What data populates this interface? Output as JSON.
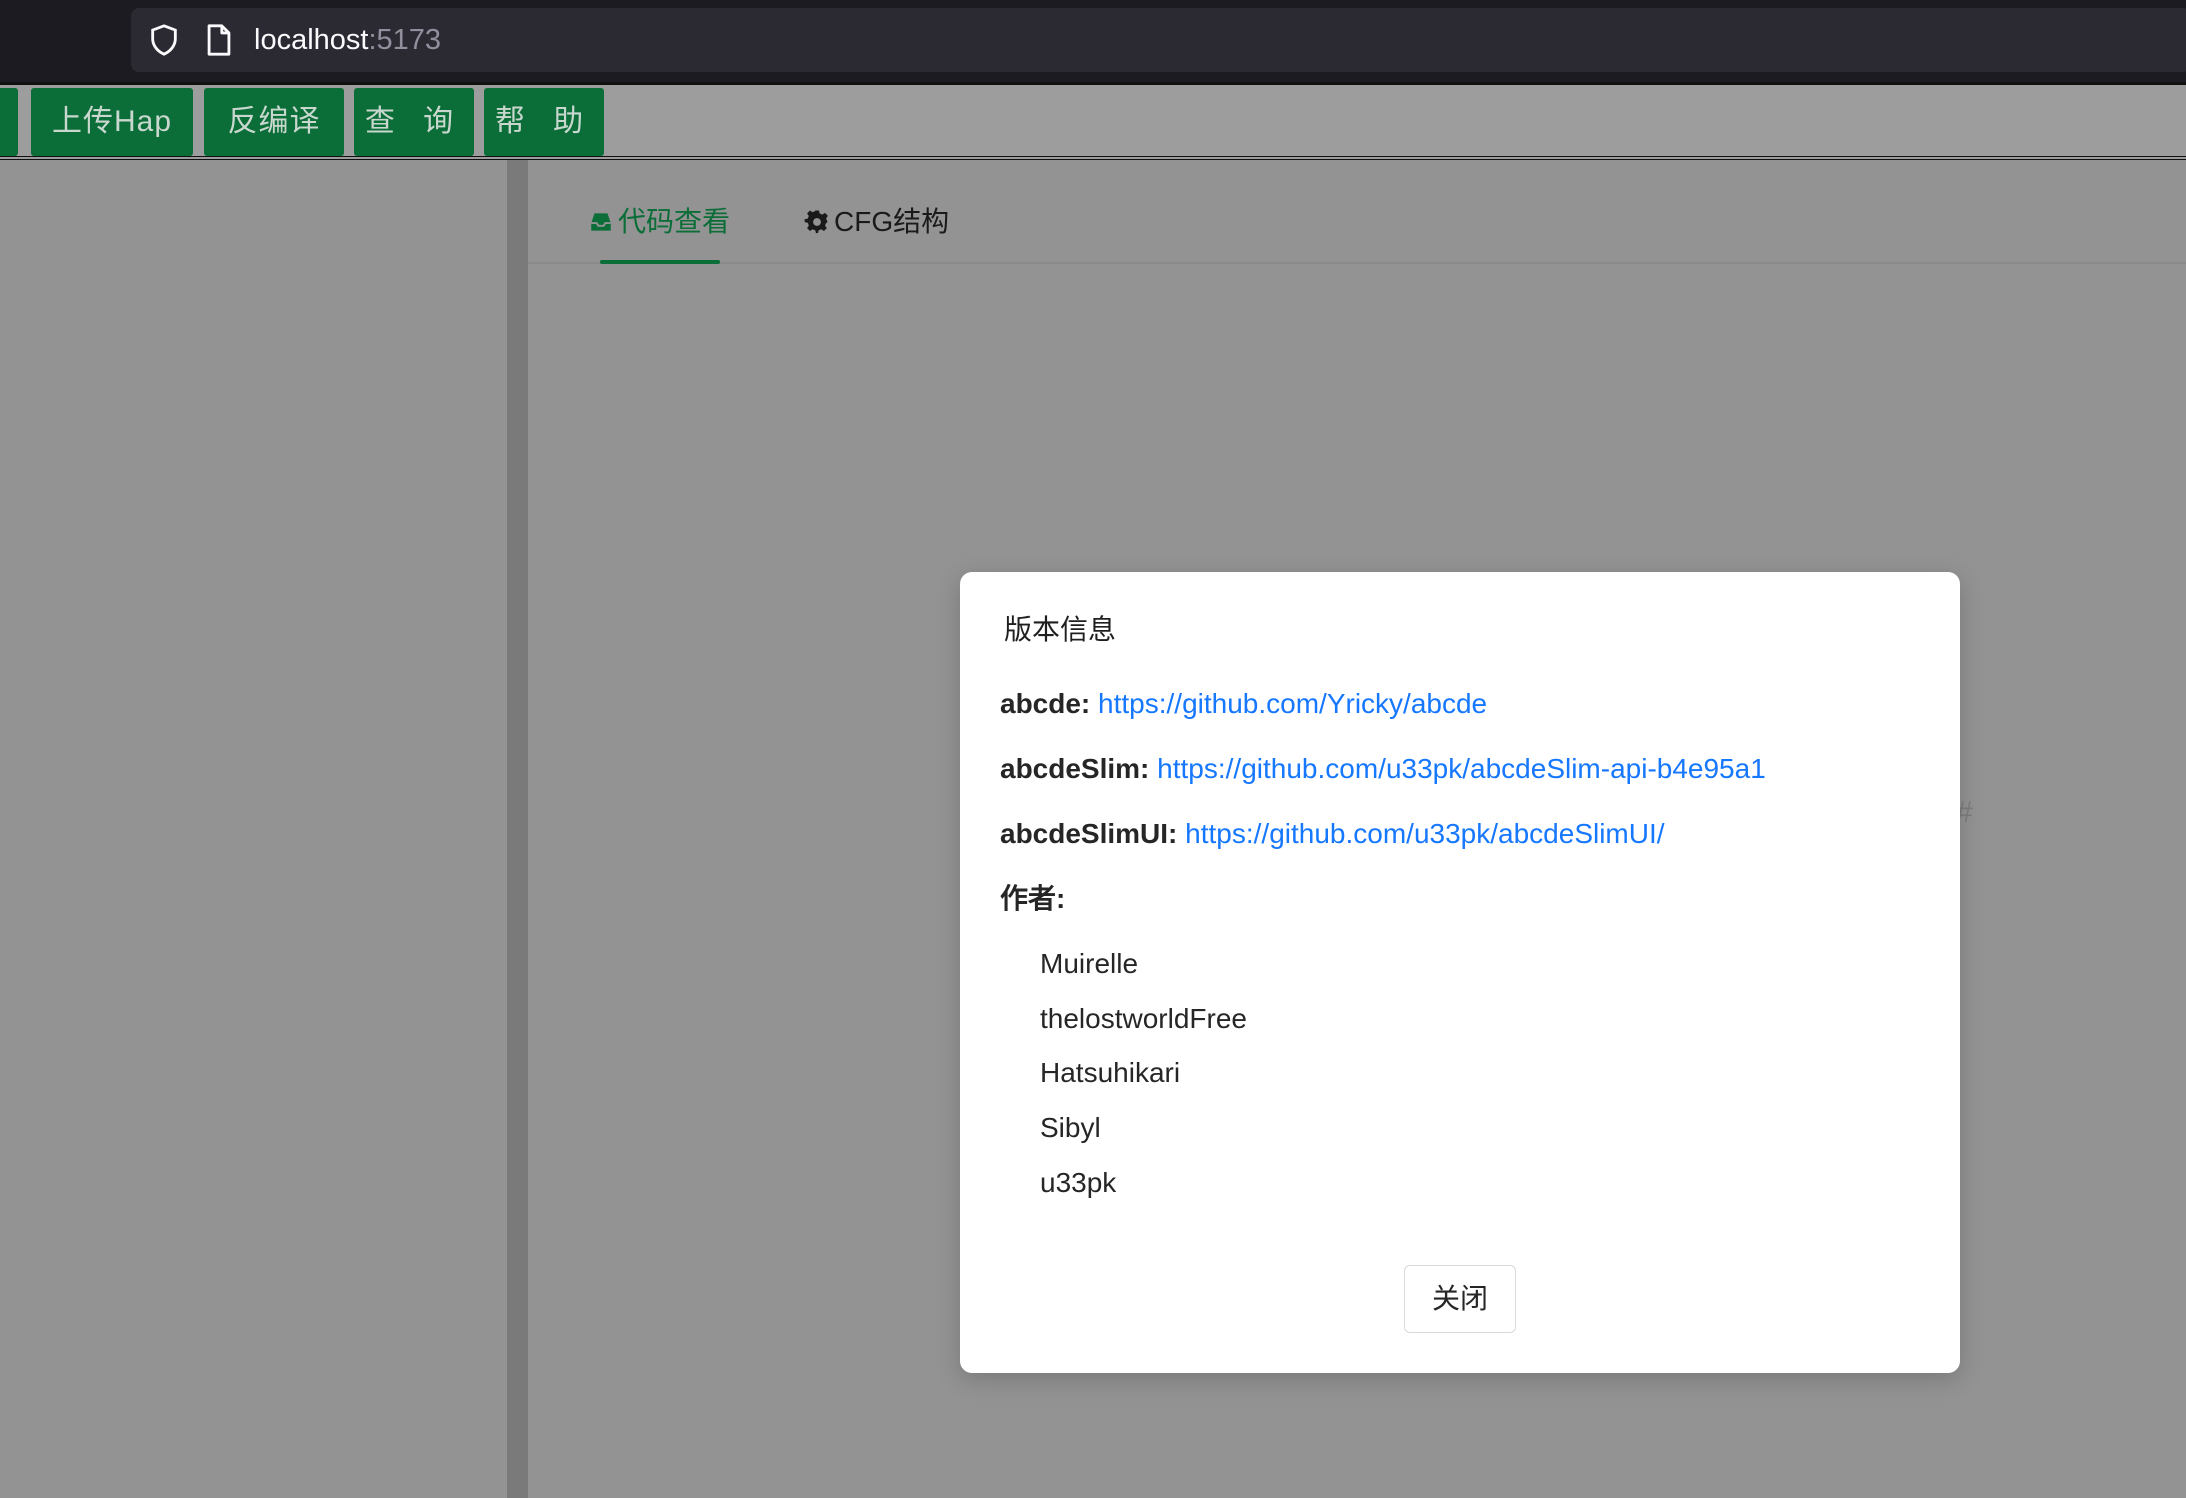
{
  "browser": {
    "url_host": "localhost",
    "url_port": ":5173",
    "icons": [
      "shield-icon",
      "page-icon"
    ]
  },
  "toolbar": {
    "buttons": [
      {
        "label": "上传Hap"
      },
      {
        "label": "反编译"
      },
      {
        "label": "查 询"
      },
      {
        "label": "帮 助"
      }
    ],
    "accent_color": "#0b6d38"
  },
  "tabs": [
    {
      "label": "代码查看",
      "icon": "inbox-icon",
      "active": true
    },
    {
      "label": "CFG结构",
      "icon": "gear-icon",
      "active": false
    }
  ],
  "background_glyph": "#",
  "modal": {
    "title": "版本信息",
    "links": [
      {
        "key": "abcde:",
        "url": "https://github.com/Yricky/abcde"
      },
      {
        "key": "abcdeSlim:",
        "url": "https://github.com/u33pk/abcdeSlim-api-b4e95a1"
      },
      {
        "key": "abcdeSlimUI:",
        "url": "https://github.com/u33pk/abcdeSlimUI/"
      }
    ],
    "authors_label": "作者:",
    "authors": [
      "Muirelle",
      "thelostworldFree",
      "Hatsuhikari",
      "Sibyl",
      "u33pk"
    ],
    "close_label": "关闭",
    "link_color": "#1677ff"
  }
}
